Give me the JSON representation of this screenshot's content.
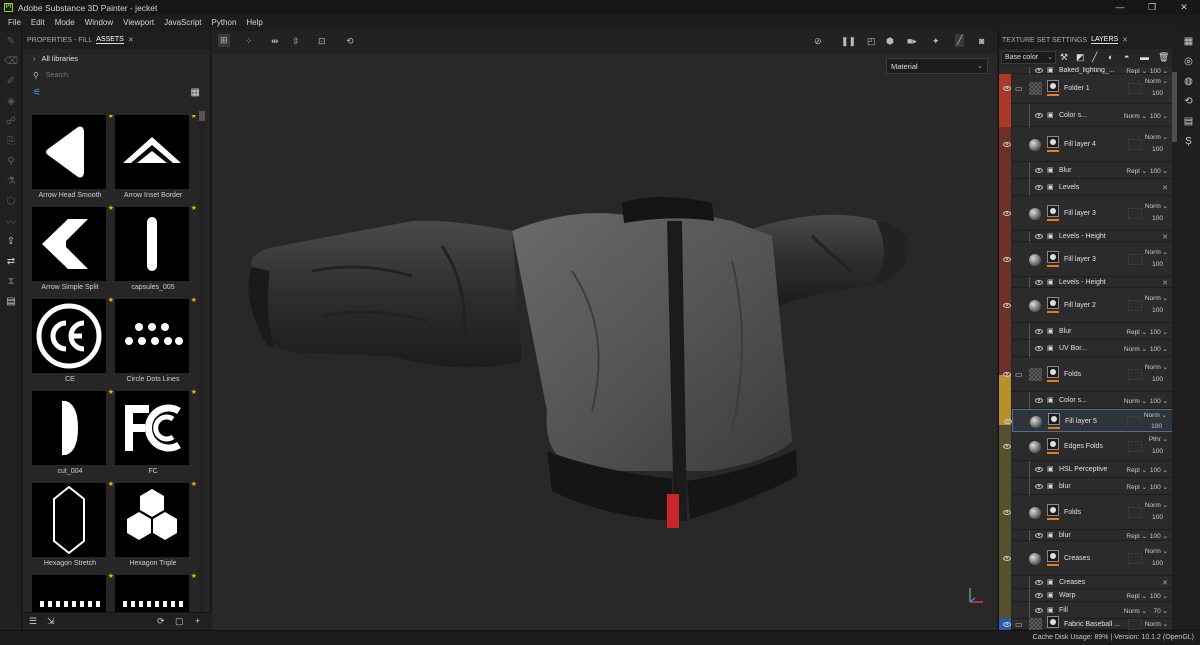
{
  "app": {
    "title": "Adobe Substance 3D Painter - jecket",
    "win_min": "—",
    "win_max": "❐",
    "win_close": "✕"
  },
  "menu": [
    "File",
    "Edit",
    "Mode",
    "Window",
    "Viewport",
    "JavaScript",
    "Python",
    "Help"
  ],
  "assets_panel": {
    "tab_properties": "PROPERTIES - FILL",
    "tab_assets": "ASSETS",
    "tab_close": "✕",
    "library": "All libraries",
    "search_placeholder": "Search",
    "tiles": [
      {
        "label": "Arrow Head Smooth"
      },
      {
        "label": "Arrow Inset Border"
      },
      {
        "label": "Arrow Simple Split"
      },
      {
        "label": "capsules_005"
      },
      {
        "label": "CE"
      },
      {
        "label": "Circle Dots Lines"
      },
      {
        "label": "cut_004"
      },
      {
        "label": "FC"
      },
      {
        "label": "Hexagon Stretch"
      },
      {
        "label": "Hexagon Triple"
      },
      {
        "label": ""
      },
      {
        "label": ""
      }
    ]
  },
  "viewport": {
    "material_mode": "Material"
  },
  "right_panel": {
    "tab_tss": "TEXTURE SET SETTINGS",
    "tab_layers": "LAYERS",
    "tab_close": "✕",
    "channel": "Base color"
  },
  "layers": [
    {
      "name": "Baked_lighting_...",
      "blend": "Repl ⌄",
      "opacity": "100 ⌄",
      "sub": true
    },
    {
      "name": "Folder 1",
      "blend": "Norm ⌄",
      "opacity": "100"
    },
    {
      "name": "Color s...",
      "blend": "Norm ⌄",
      "opacity": "100 ⌄",
      "sub": true
    },
    {
      "name": "Fill layer 4",
      "blend": "Norm ⌄",
      "opacity": "100"
    },
    {
      "name": "Blur",
      "blend": "Repl ⌄",
      "opacity": "100 ⌄",
      "sub": true
    },
    {
      "name": "Levels",
      "blend": "",
      "opacity": "",
      "sub": true
    },
    {
      "name": "Fill layer 3",
      "blend": "Norm ⌄",
      "opacity": "100"
    },
    {
      "name": "Levels - Height",
      "blend": "",
      "opacity": "",
      "sub": true
    },
    {
      "name": "Fill layer 3",
      "blend": "Norm ⌄",
      "opacity": "100"
    },
    {
      "name": "Levels - Height",
      "blend": "",
      "opacity": "",
      "sub": true
    },
    {
      "name": "Fill layer 2",
      "blend": "Norm ⌄",
      "opacity": "100"
    },
    {
      "name": "Blur",
      "blend": "Repl ⌄",
      "opacity": "100 ⌄",
      "sub": true
    },
    {
      "name": "UV Bor...",
      "blend": "Norm ⌄",
      "opacity": "100 ⌄",
      "sub": true
    },
    {
      "name": "Folds",
      "blend": "Norm ⌄",
      "opacity": "100"
    },
    {
      "name": "Color s...",
      "blend": "Norm ⌄",
      "opacity": "100 ⌄",
      "sub": true
    },
    {
      "name": "Fill layer 5",
      "blend": "Norm ⌄",
      "opacity": "100"
    },
    {
      "name": "Edges Folds",
      "blend": "Pthr ⌄",
      "opacity": "100"
    },
    {
      "name": "HSL Perceptive",
      "blend": "Repl ⌄",
      "opacity": "100 ⌄",
      "sub": true
    },
    {
      "name": "blur",
      "blend": "Repl ⌄",
      "opacity": "100 ⌄",
      "sub": true
    },
    {
      "name": "Folds",
      "blend": "Norm ⌄",
      "opacity": "100"
    },
    {
      "name": "blur",
      "blend": "Repl ⌄",
      "opacity": "100 ⌄",
      "sub": true
    },
    {
      "name": "Creases",
      "blend": "Norm ⌄",
      "opacity": "100"
    },
    {
      "name": "Creases",
      "blend": "",
      "opacity": "",
      "sub": true
    },
    {
      "name": "Warp",
      "blend": "Repl ⌄",
      "opacity": "100 ⌄",
      "sub": true
    },
    {
      "name": "Fill",
      "blend": "Norm ⌄",
      "opacity": "70 ⌄",
      "sub": true
    },
    {
      "name": "Fabric Baseball ...",
      "blend": "Norm ⌄",
      "opacity": ""
    }
  ],
  "status": {
    "text": "Cache Disk Usage:   89% | Version: 10.1.2 (OpenGL)"
  },
  "colors": {
    "folder_red": "#a83a2a",
    "fill_red": "#6e3028",
    "folder_gold": "#b8902a",
    "fill_olive": "#55502e",
    "folder_blue": "#2a5aa8",
    "accent_orange": "#e87a1a",
    "tag_red": "#c8262a"
  }
}
